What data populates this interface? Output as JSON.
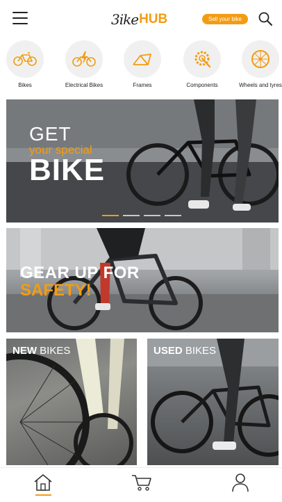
{
  "header": {
    "logo_mark": "3ike",
    "logo_hub": "HUB",
    "sell_label": "Sell your bike"
  },
  "categories": [
    {
      "label": "Bikes",
      "icon": "bicycle-icon"
    },
    {
      "label": "Electrical Bikes",
      "icon": "electric-bike-icon"
    },
    {
      "label": "Frames",
      "icon": "frame-icon"
    },
    {
      "label": "Components",
      "icon": "chainring-icon"
    },
    {
      "label": "Wheels and tyres",
      "icon": "wheel-icon"
    }
  ],
  "hero": {
    "line1": "GET",
    "line2": "your special",
    "line3": "BIKE",
    "slide_count": 4,
    "active_slide": 1
  },
  "safety": {
    "line1": "GEAR UP FOR",
    "line2": "SAFETY!"
  },
  "tiles": {
    "new_bold": "NEW",
    "new_rest": " BIKES",
    "used_bold": "USED",
    "used_rest": " BIKES"
  },
  "nav": {
    "items": [
      "home-icon",
      "cart-icon",
      "profile-icon"
    ],
    "active": "home-icon"
  },
  "colors": {
    "accent": "#f39c12",
    "text": "#222222",
    "icon_bg": "#f0f0f0"
  }
}
